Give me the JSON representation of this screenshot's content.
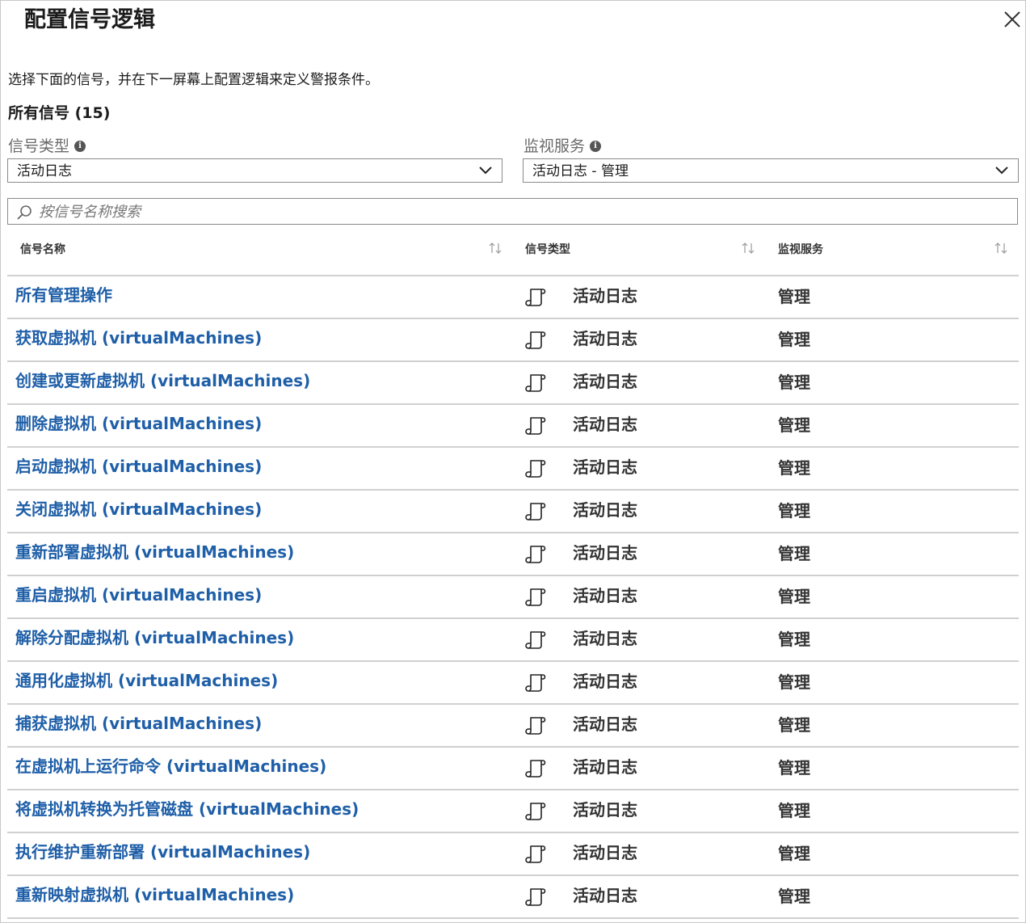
{
  "header": {
    "title": "配置信号逻辑",
    "close_icon": "close-icon"
  },
  "description": "选择下面的信号，并在下一屏幕上配置逻辑来定义警报条件。",
  "all_signals_label": "所有信号 (15)",
  "filters": {
    "signal_type": {
      "label": "信号类型",
      "value": "活动日志"
    },
    "monitor_service": {
      "label": "监视服务",
      "value": "活动日志 - 管理"
    }
  },
  "search": {
    "placeholder": "按信号名称搜索"
  },
  "table": {
    "columns": [
      "信号名称",
      "信号类型",
      "监视服务"
    ],
    "rows": [
      {
        "name": "所有管理操作",
        "type": "活动日志",
        "service": "管理"
      },
      {
        "name": "获取虚拟机 (virtualMachines)",
        "type": "活动日志",
        "service": "管理"
      },
      {
        "name": "创建或更新虚拟机 (virtualMachines)",
        "type": "活动日志",
        "service": "管理"
      },
      {
        "name": "删除虚拟机 (virtualMachines)",
        "type": "活动日志",
        "service": "管理"
      },
      {
        "name": "启动虚拟机 (virtualMachines)",
        "type": "活动日志",
        "service": "管理"
      },
      {
        "name": "关闭虚拟机 (virtualMachines)",
        "type": "活动日志",
        "service": "管理"
      },
      {
        "name": "重新部署虚拟机 (virtualMachines)",
        "type": "活动日志",
        "service": "管理"
      },
      {
        "name": "重启虚拟机 (virtualMachines)",
        "type": "活动日志",
        "service": "管理"
      },
      {
        "name": "解除分配虚拟机 (virtualMachines)",
        "type": "活动日志",
        "service": "管理"
      },
      {
        "name": "通用化虚拟机 (virtualMachines)",
        "type": "活动日志",
        "service": "管理"
      },
      {
        "name": "捕获虚拟机 (virtualMachines)",
        "type": "活动日志",
        "service": "管理"
      },
      {
        "name": "在虚拟机上运行命令 (virtualMachines)",
        "type": "活动日志",
        "service": "管理"
      },
      {
        "name": "将虚拟机转换为托管磁盘 (virtualMachines)",
        "type": "活动日志",
        "service": "管理"
      },
      {
        "name": "执行维护重新部署 (virtualMachines)",
        "type": "活动日志",
        "service": "管理"
      },
      {
        "name": "重新映射虚拟机 (virtualMachines)",
        "type": "活动日志",
        "service": "管理"
      }
    ]
  },
  "colors": {
    "link": "#1f5fa8",
    "border": "#d0d0d0",
    "text": "#333333"
  }
}
